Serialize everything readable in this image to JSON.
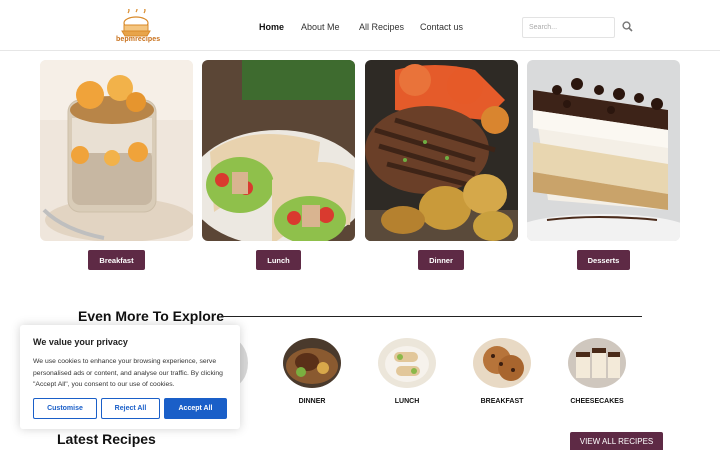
{
  "brand": {
    "logo_text": "bepmrecipes"
  },
  "nav": {
    "home": "Home",
    "about": "About Me",
    "recipes": "All Recipes",
    "contact": "Contact us"
  },
  "search": {
    "placeholder": "Search..."
  },
  "categories": [
    {
      "label": "Breakfast"
    },
    {
      "label": "Lunch"
    },
    {
      "label": "Dinner"
    },
    {
      "label": "Desserts"
    }
  ],
  "explore": {
    "title": "Even More To Explore",
    "items": [
      {
        "label": "DINNER"
      },
      {
        "label": "LUNCH"
      },
      {
        "label": "BREAKFAST"
      },
      {
        "label": "CHEESECAKES"
      }
    ]
  },
  "latest": {
    "title": "Latest Recipes",
    "view_all": "VIEW ALL RECIPES"
  },
  "cookie": {
    "title": "We value your privacy",
    "text": "We use cookies to enhance your browsing experience, serve personalised ads or content, and analyse our traffic. By clicking \"Accept All\", you consent to our use of cookies.",
    "customise": "Customise",
    "reject": "Reject All",
    "accept": "Accept All"
  },
  "colors": {
    "accent": "#5e2a45",
    "cookie_blue": "#1a5fc8"
  }
}
